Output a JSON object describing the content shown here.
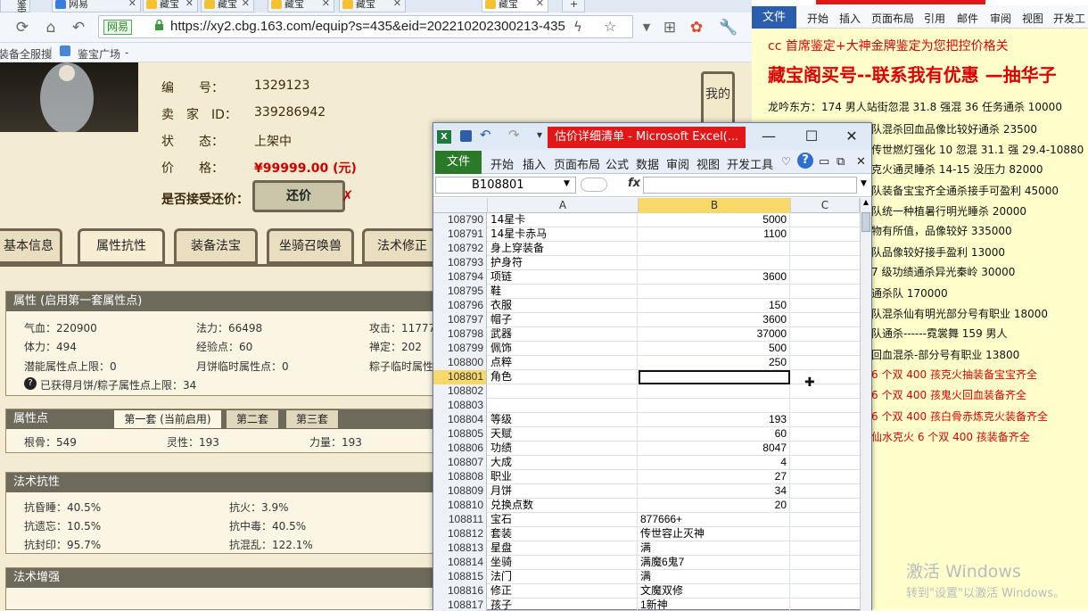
{
  "browser": {
    "tabs": [
      "鉴宝",
      "网易",
      "藏宝",
      "藏宝",
      "藏宝",
      "藏宝",
      "藏宝"
    ],
    "new_tab": "+",
    "url_cert": "网易",
    "url": "https://xy2.cbg.163.com/equip?s=435&eid=202210202300213-435",
    "bookmarks": [
      "装备全服搜",
      "鉴宝广场"
    ],
    "bookmark_arrow": "-"
  },
  "listing": {
    "labels": {
      "serial": "编　　号：",
      "seller": "卖　家　ID：",
      "status": "状　　态：",
      "price": "价　　格：",
      "accept_offer": "是否接受还价："
    },
    "serial": "1329123",
    "seller_id": "339286942",
    "status": "上架中",
    "price": "¥99999.00 (元)",
    "offer_button": "还价",
    "offer_x": "✗",
    "side_button": "我的",
    "tabs": [
      "基本信息",
      "属性抗性",
      "装备法宝",
      "坐骑召唤兽",
      "法术修正"
    ],
    "attr_section": {
      "title": "属性 (启用第一套属性点)",
      "items": [
        "气血：220900",
        "法力：66498",
        "攻击：11777",
        "体力：494",
        "经验点：60",
        "禅定：202",
        "潜能属性点上限：0",
        "月饼临时属性点：0",
        "粽子临时属性"
      ],
      "note": "已获得月饼/粽子属性点上限：34",
      "note_icon": "?"
    },
    "points_section": {
      "title": "属性点",
      "tabs": [
        "第一套 (当前启用)",
        "第二套",
        "第三套"
      ],
      "items": [
        "根骨：549",
        "灵性：193",
        "力量：193"
      ]
    },
    "resist_section": {
      "title": "法术抗性",
      "items": [
        "抗昏睡：40.5%",
        "抗火：3.9%",
        "抗遗忘：10.5%",
        "抗中毒：40.5%",
        "抗封印：95.7%",
        "抗混乱：122.1%"
      ]
    },
    "enhance_section": {
      "title": "法术增强"
    }
  },
  "excel": {
    "title": "估价详细清单 - Microsoft Excel(...",
    "win_buttons": [
      "—",
      "☐",
      "✕"
    ],
    "file_tab": "文件",
    "ribbon_tabs": [
      "开始",
      "插入",
      "页面布局",
      "公式",
      "数据",
      "审阅",
      "视图",
      "开发工具"
    ],
    "name_box": "B108801",
    "fx": "fx",
    "columns": [
      "A",
      "B",
      "C"
    ],
    "rows": [
      {
        "n": "108790",
        "a": "14星卡",
        "b": "5000",
        "num": true
      },
      {
        "n": "108791",
        "a": "14星卡赤马",
        "b": "1100",
        "num": true
      },
      {
        "n": "108792",
        "a": "身上穿装备",
        "b": "",
        "num": true
      },
      {
        "n": "108793",
        "a": "护身符",
        "b": "",
        "num": true
      },
      {
        "n": "108794",
        "a": "项链",
        "b": "3600",
        "num": true
      },
      {
        "n": "108795",
        "a": "鞋",
        "b": "",
        "num": true
      },
      {
        "n": "108796",
        "a": "衣服",
        "b": "150",
        "num": true
      },
      {
        "n": "108797",
        "a": "帽子",
        "b": "3600",
        "num": true
      },
      {
        "n": "108798",
        "a": "武器",
        "b": "37000",
        "num": true
      },
      {
        "n": "108799",
        "a": "佩饰",
        "b": "500",
        "num": true
      },
      {
        "n": "108800",
        "a": "点粹",
        "b": "250",
        "num": true
      },
      {
        "n": "108801",
        "a": "角色",
        "b": "",
        "num": true
      },
      {
        "n": "108802",
        "a": "",
        "b": "",
        "num": true
      },
      {
        "n": "108803",
        "a": "",
        "b": "",
        "num": true
      },
      {
        "n": "108804",
        "a": "等级",
        "b": "193",
        "num": true
      },
      {
        "n": "108805",
        "a": "天赋",
        "b": "60",
        "num": true
      },
      {
        "n": "108806",
        "a": "功绩",
        "b": "8047",
        "num": true
      },
      {
        "n": "108807",
        "a": "大成",
        "b": "4",
        "num": true
      },
      {
        "n": "108808",
        "a": "职业",
        "b": "27",
        "num": true
      },
      {
        "n": "108809",
        "a": "月饼",
        "b": "34",
        "num": true
      },
      {
        "n": "108810",
        "a": "兑换点数",
        "b": "20",
        "num": true
      },
      {
        "n": "108811",
        "a": "宝石",
        "b": "877666+",
        "num": false
      },
      {
        "n": "108812",
        "a": "套装",
        "b": "传世容止灭神",
        "num": false
      },
      {
        "n": "108813",
        "a": "星盘",
        "b": "满",
        "num": false
      },
      {
        "n": "108814",
        "a": "坐骑",
        "b": "满魔6鬼7",
        "num": false
      },
      {
        "n": "108815",
        "a": "法门",
        "b": "满",
        "num": false
      },
      {
        "n": "108816",
        "a": "修正",
        "b": "文魔双修",
        "num": false
      },
      {
        "n": "108817",
        "a": "孩子",
        "b": "1新神",
        "num": false
      }
    ],
    "selected_row": "108801"
  },
  "word": {
    "file_tab": "文件",
    "ribbon_tabs": [
      "开始",
      "插入",
      "页面布局",
      "引用",
      "邮件",
      "审阅",
      "视图",
      "开发工"
    ],
    "lines": [
      {
        "t": "cc 首席鉴定+大神金牌鉴定为您把控价格关",
        "c": "hd"
      },
      {
        "t": "藏宝阁买号--联系我有优惠 —抽华子",
        "c": "big"
      },
      {
        "t": "龙吟东方：174 男人站街忽混 31.8 强混 36 任务通杀 10000",
        "c": ""
      },
      {
        "t": "队混杀回血品像比较好通杀 23500",
        "c": ""
      },
      {
        "t": "传世燃灯强化 10 忽混 31.1 强 29.4-10880",
        "c": ""
      },
      {
        "t": "克火通灵睡杀 14-15 没压力 82000",
        "c": ""
      },
      {
        "t": "队装备宝宝齐全通杀接手可盈利 45000",
        "c": ""
      },
      {
        "t": "队统一种植暑行明光睡杀 20000",
        "c": ""
      },
      {
        "t": "物有所值，品像较好 335000",
        "c": ""
      },
      {
        "t": "队品像较好接手盈利 13000",
        "c": ""
      },
      {
        "t": "7 级功绩通杀异光秦岭 30000",
        "c": ""
      },
      {
        "t": "通杀队 170000",
        "c": ""
      },
      {
        "t": "队混杀仙有明光部分号有职业 18000",
        "c": ""
      },
      {
        "t": "队通杀------霓裳舞 159 男人",
        "c": ""
      },
      {
        "t": "回血混杀-部分号有职业 13800",
        "c": ""
      },
      {
        "t": "6 个双 400 孩克火抽装备宝宝齐全",
        "c": "red"
      },
      {
        "t": "6 个双 400 孩鬼火回血装备齐全",
        "c": "red"
      },
      {
        "t": "6 个双 400 孩白骨赤炼克火装备齐全",
        "c": "red"
      },
      {
        "t": "仙水克火 6 个双 400 孩装备齐全",
        "c": "red"
      }
    ],
    "watermark1": "激活 Windows",
    "watermark2": "转到\"设置\"以激活 Windows。"
  }
}
